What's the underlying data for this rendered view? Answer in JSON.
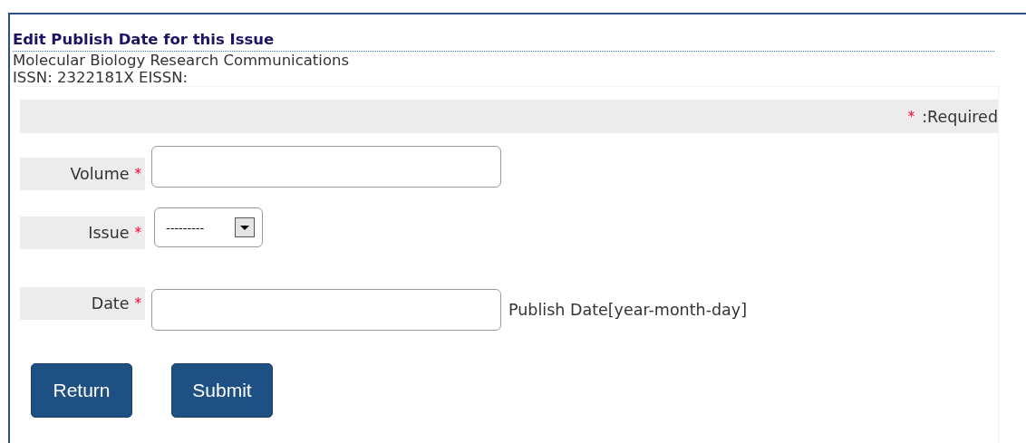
{
  "title": "Edit Publish Date for this Issue",
  "journal": "Molecular Biology Research Communications",
  "issn": "ISSN: 2322181X EISSN:",
  "required_note": {
    "mark": "*",
    "text": ":Required"
  },
  "fields": [
    {
      "kind": "text",
      "label": "Volume",
      "required": true
    },
    {
      "kind": "select",
      "label": "Issue",
      "required": true,
      "value": "---------"
    },
    {
      "kind": "text",
      "label": "Date",
      "required": true,
      "hint": "Publish Date[year-month-day]"
    }
  ],
  "buttons": [
    "Return",
    "Submit"
  ]
}
